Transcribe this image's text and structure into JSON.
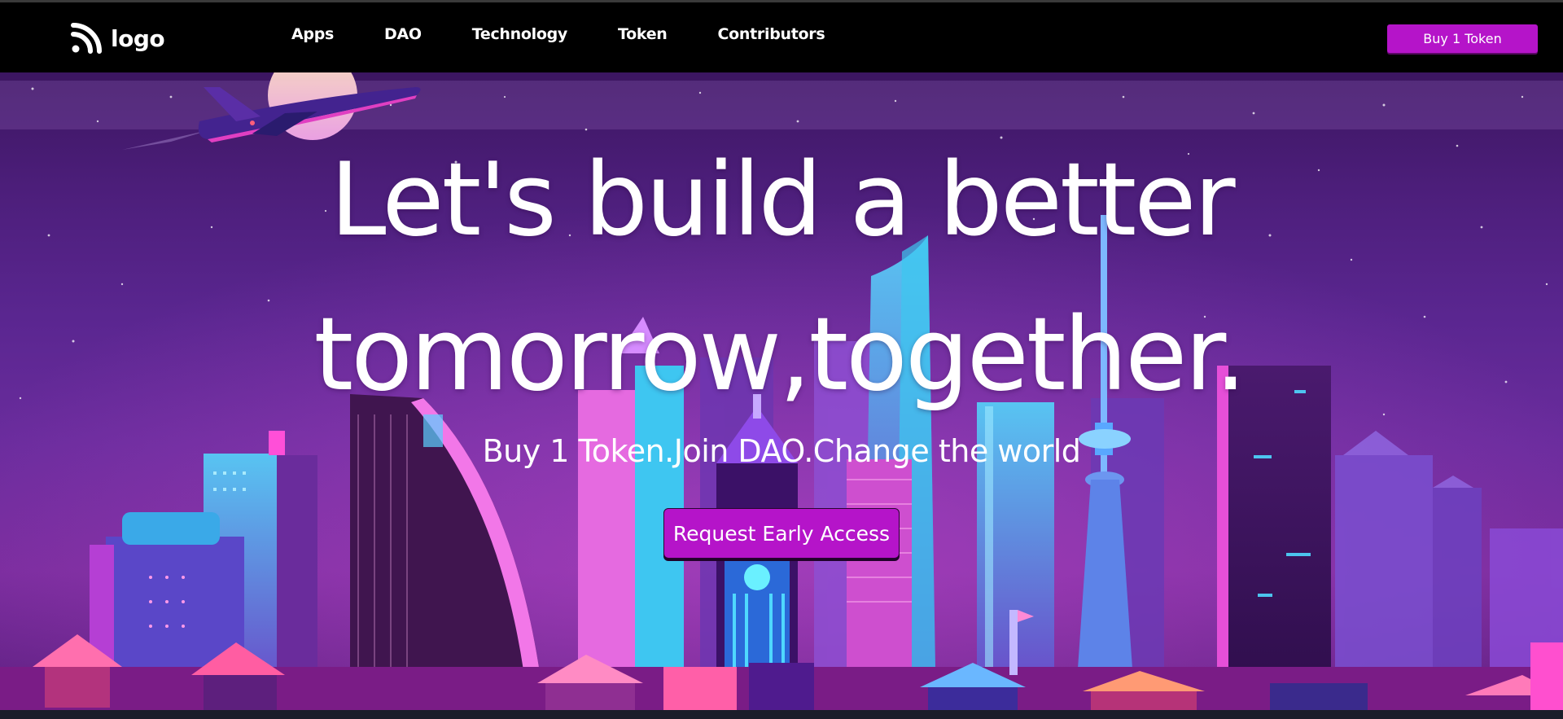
{
  "navbar": {
    "logo_text": "logo",
    "links": [
      "Apps",
      "DAO",
      "Technology",
      "Token",
      "Contributors"
    ],
    "buy_button_label": "Buy 1 Token"
  },
  "hero": {
    "headline_line1": "Let's build a better",
    "headline_line2": "tomorrow,together.",
    "subtitle": "Buy 1 Token.Join DAO.Change the world",
    "cta_label": "Request Early Access"
  },
  "colors": {
    "accent": "#b514c9",
    "navbar_bg": "#000000",
    "sky_top": "#3c1661",
    "sky_bottom": "#7a2d9e"
  },
  "icons": {
    "logo": "feed-icon",
    "illustration": "city-skyline-with-airplane"
  }
}
